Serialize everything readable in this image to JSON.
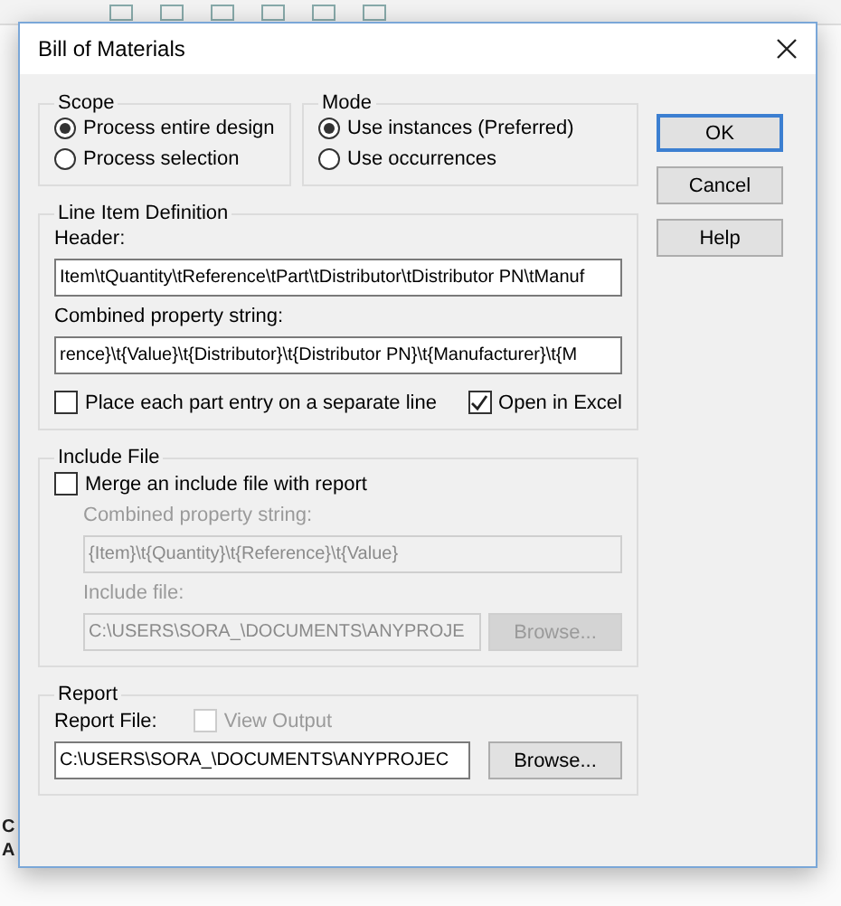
{
  "window": {
    "title": "Bill of Materials"
  },
  "scope": {
    "legend": "Scope",
    "options": [
      {
        "label": "Process entire design",
        "selected": true
      },
      {
        "label": "Process selection",
        "selected": false
      }
    ]
  },
  "mode": {
    "legend": "Mode",
    "options": [
      {
        "label": "Use instances (Preferred)",
        "selected": true
      },
      {
        "label": "Use occurrences",
        "selected": false
      }
    ]
  },
  "line_item": {
    "legend": "Line Item Definition",
    "header_label": "Header:",
    "header_value": "Item\\tQuantity\\tReference\\tPart\\tDistributor\\tDistributor PN\\tManuf",
    "combined_label": "Combined property string:",
    "combined_value": "rence}\\t{Value}\\t{Distributor}\\t{Distributor PN}\\t{Manufacturer}\\t{M",
    "checkboxes": [
      {
        "label": "Place each part entry on a separate line",
        "checked": false
      },
      {
        "label": "Open in Excel",
        "checked": true
      }
    ]
  },
  "include_file": {
    "legend": "Include File",
    "merge": {
      "label": "Merge an include file with report",
      "checked": false
    },
    "disabled": true,
    "combined_label": "Combined property string:",
    "combined_value": "{Item}\\t{Quantity}\\t{Reference}\\t{Value}",
    "include_label": "Include file:",
    "include_value": "C:\\USERS\\SORA_\\DOCUMENTS\\ANYPROJE",
    "browse": "Browse..."
  },
  "report": {
    "legend": "Report",
    "file_label": "Report File:",
    "view_output": {
      "label": "View Output",
      "checked": false,
      "disabled": true
    },
    "path": "C:\\USERS\\SORA_\\DOCUMENTS\\ANYPROJEC",
    "browse": "Browse..."
  },
  "buttons": [
    {
      "label": "OK",
      "default": true
    },
    {
      "label": "Cancel",
      "default": false
    },
    {
      "label": "Help",
      "default": false
    }
  ],
  "background": {
    "fragments": [
      "C",
      "A"
    ]
  }
}
